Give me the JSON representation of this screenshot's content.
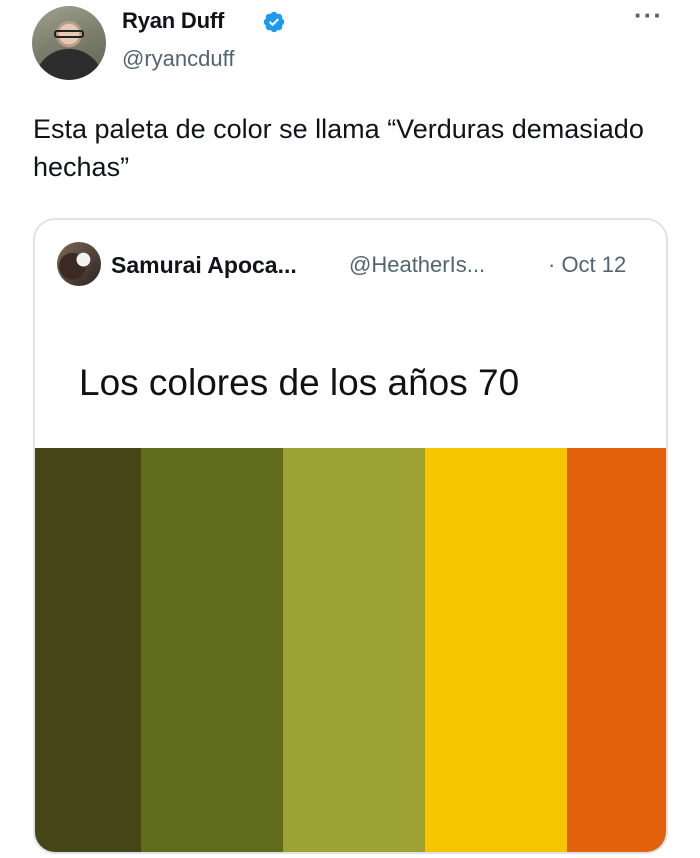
{
  "tweet": {
    "author": {
      "name": "Ryan Duff",
      "handle": "@ryancduff",
      "verified": true
    },
    "more_icon": "more-dots-icon",
    "more_label": "···",
    "text": "Esta paleta de color se llama “Verduras demasiado hechas”"
  },
  "quote": {
    "author_name": "Samurai Apoca...",
    "author_handle": "@HeatherIs...",
    "date": "· Oct 12",
    "image_caption": "Los colores de los años 70",
    "palette": [
      {
        "color": "#454517"
      },
      {
        "color": "#5e6c1c"
      },
      {
        "color": "#9da234"
      },
      {
        "color": "#f6c500"
      },
      {
        "color": "#e2620e"
      }
    ]
  },
  "colors": {
    "verified_badge": "#1d9bf0",
    "secondary_text": "#536471",
    "card_border": "#dfe3e7"
  }
}
